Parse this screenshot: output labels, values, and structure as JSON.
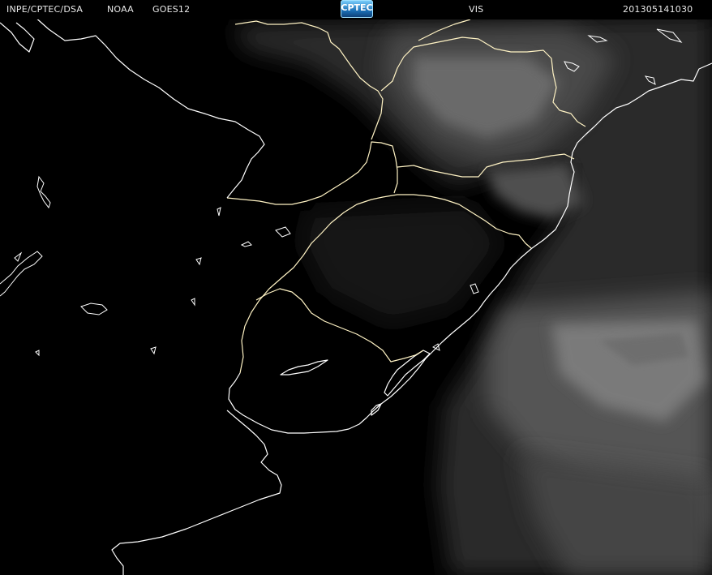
{
  "header": {
    "source": "INPE/CPTEC/DSA",
    "agency": "NOAA",
    "satellite": "GOES12",
    "logo_text": "CPTEC",
    "channel": "VIS",
    "timestamp": "201305141030"
  },
  "colors": {
    "background": "#000000",
    "coastline": "#ffffff",
    "boundary": "#fff8d8",
    "cloud": "#bdbdbd"
  }
}
